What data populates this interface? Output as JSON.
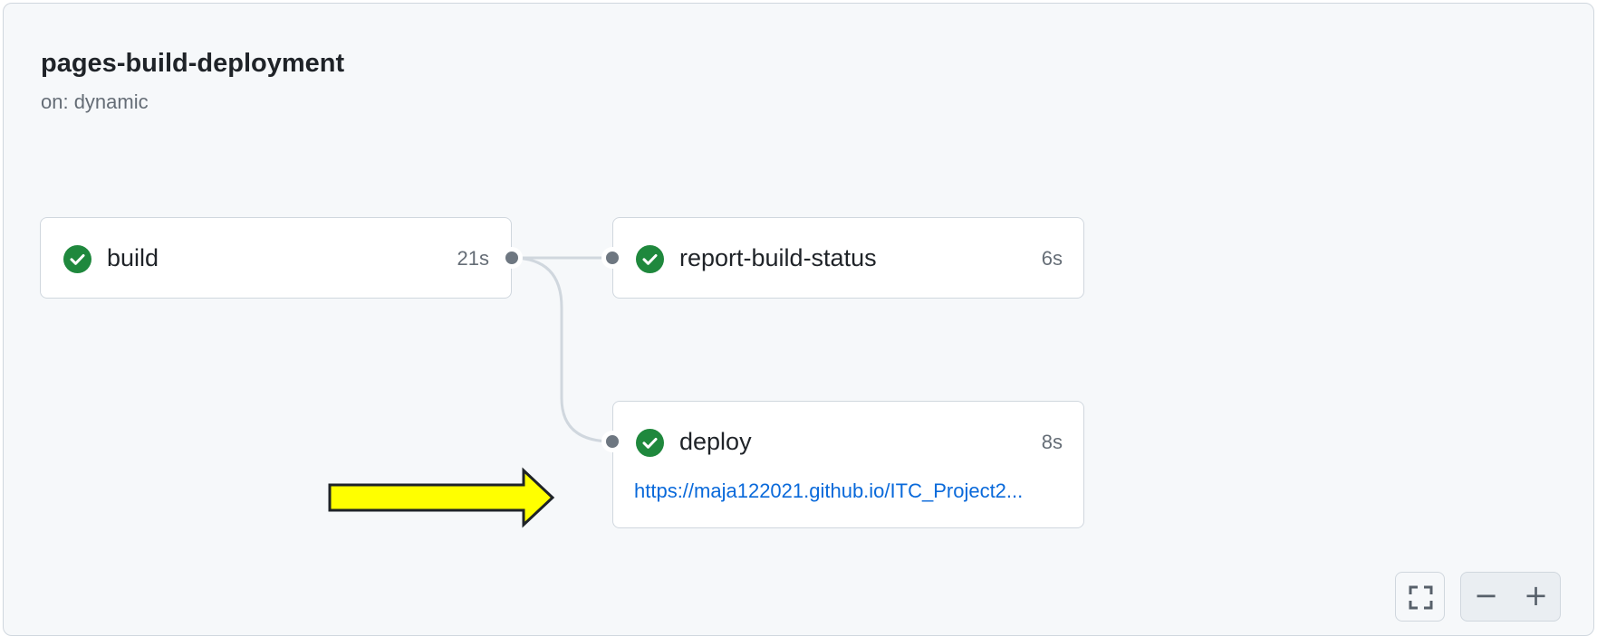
{
  "workflow": {
    "title": "pages-build-deployment",
    "trigger": "on: dynamic"
  },
  "jobs": [
    {
      "name": "build",
      "duration": "21s",
      "status": "success"
    },
    {
      "name": "report-build-status",
      "duration": "6s",
      "status": "success"
    },
    {
      "name": "deploy",
      "duration": "8s",
      "status": "success",
      "link": "https://maja122021.github.io/ITC_Project2..."
    }
  ],
  "controls": {
    "zoom_out": "−",
    "zoom_in": "+"
  },
  "icons": {
    "status": "check-circle-icon",
    "fullscreen": "fullscreen-icon",
    "annotation": "arrow-right-icon"
  },
  "colors": {
    "success": "#1f883d",
    "link": "#0969da",
    "annotation_arrow": "#ffff00"
  }
}
